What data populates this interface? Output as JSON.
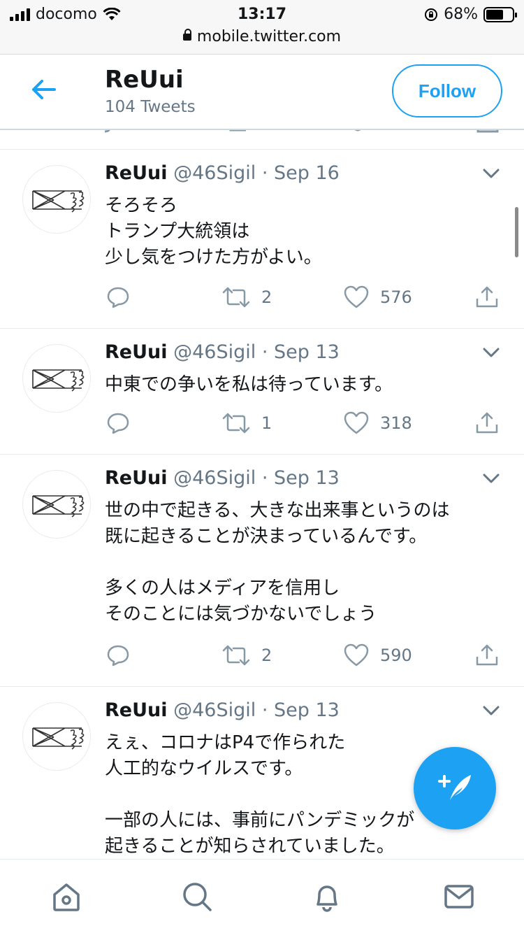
{
  "status_bar": {
    "carrier": "docomo",
    "time": "13:17",
    "battery": "68%",
    "battery_level": 0.68,
    "url": "mobile.twitter.com"
  },
  "header": {
    "title": "ReUui",
    "subtitle": "104 Tweets",
    "follow_label": "Follow"
  },
  "tweets": [
    {
      "name": "ReUui",
      "handle": "@46Sigil",
      "dot": "·",
      "date": "Sep 16",
      "text": "そろそろ\nトランプ大統領は\n少し気をつけた方がよい。",
      "retweets": "2",
      "likes": "576"
    },
    {
      "name": "ReUui",
      "handle": "@46Sigil",
      "dot": "·",
      "date": "Sep 13",
      "text": "中東での争いを私は待っています。",
      "retweets": "1",
      "likes": "318"
    },
    {
      "name": "ReUui",
      "handle": "@46Sigil",
      "dot": "·",
      "date": "Sep 13",
      "text": "世の中で起きる、大きな出来事というのは\n既に起きることが決まっているんです。\n\n多くの人はメディアを信用し\nそのことには気づかないでしょう",
      "retweets": "2",
      "likes": "590"
    },
    {
      "name": "ReUui",
      "handle": "@46Sigil",
      "dot": "·",
      "date": "Sep 13",
      "text": "えぇ、コロナはP4で作られた\n人工的なウイルスです。\n\n一部の人には、事前にパンデミックが\n起きることが知らされていました。",
      "retweets": "",
      "likes": ""
    }
  ],
  "colors": {
    "accent": "#1da1f2",
    "secondary_text": "#657786",
    "divider": "#e6ecf0"
  },
  "icons": {
    "back": "arrow-left-icon",
    "reply": "reply-icon",
    "retweet": "retweet-icon",
    "like": "heart-icon",
    "share": "share-icon",
    "more": "chevron-down-icon",
    "compose": "compose-icon",
    "home": "home-icon",
    "search": "search-icon",
    "notifications": "bell-icon",
    "messages": "mail-icon"
  }
}
